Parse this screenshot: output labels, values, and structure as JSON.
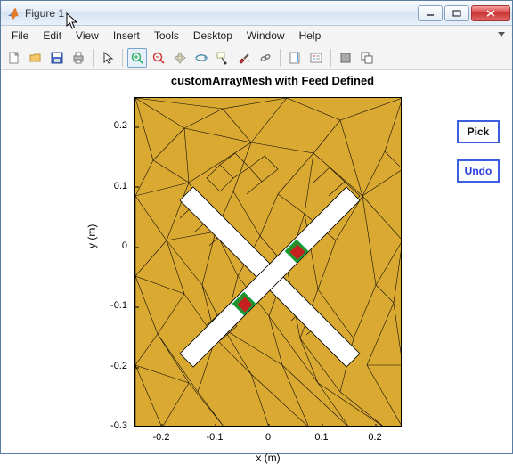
{
  "window": {
    "title": "Figure 1"
  },
  "menu": {
    "file": "File",
    "edit": "Edit",
    "view": "View",
    "insert": "Insert",
    "tools": "Tools",
    "desktop": "Desktop",
    "window": "Window",
    "help": "Help"
  },
  "plot": {
    "title": "customArrayMesh with Feed Defined",
    "xlabel": "x (m)",
    "ylabel": "y (m)",
    "xticks": [
      "-0.2",
      "-0.1",
      "0",
      "0.1",
      "0.2"
    ],
    "yticks": [
      "-0.3",
      "-0.2",
      "-0.1",
      "0",
      "0.1",
      "0.2"
    ]
  },
  "buttons": {
    "pick": "Pick",
    "undo": "Undo"
  },
  "toolbar_icons": [
    "new",
    "open",
    "save",
    "print",
    "sep",
    "pointer",
    "sep",
    "zoom-in",
    "zoom-out",
    "pan",
    "rotate3d",
    "datacursor",
    "brush",
    "link",
    "sep",
    "colorbar",
    "legend",
    "sep",
    "hide",
    "dock"
  ],
  "chart_data": {
    "type": "area",
    "title": "customArrayMesh with Feed Defined",
    "xlabel": "x (m)",
    "ylabel": "y (m)",
    "xlim": [
      -0.25,
      0.25
    ],
    "ylim": [
      -0.3,
      0.25
    ],
    "mesh": "triangular mesh over rectangular domain with two diagonal white slot arms forming an X",
    "feeds": [
      {
        "x": 0.06,
        "y": 0.03,
        "color": "red"
      },
      {
        "x": -0.02,
        "y": -0.05,
        "color": "red"
      }
    ]
  }
}
